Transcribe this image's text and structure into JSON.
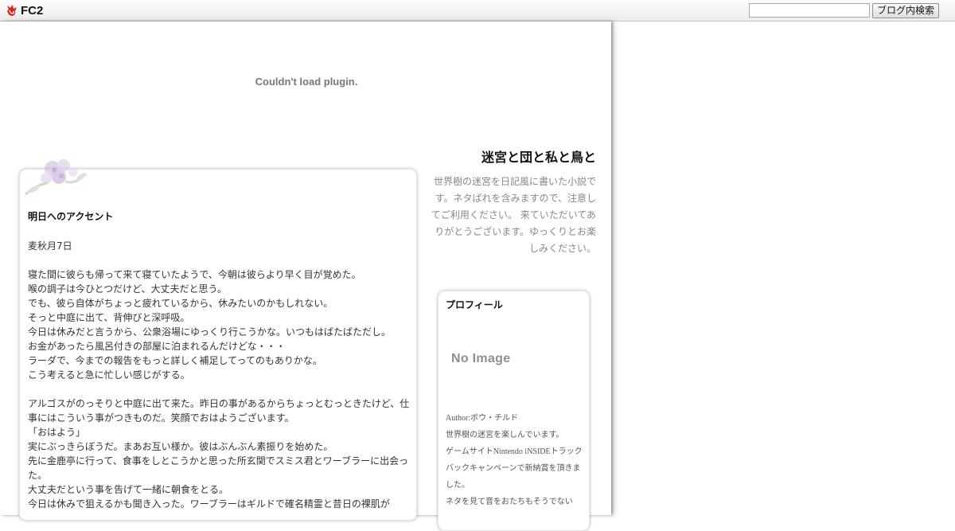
{
  "topbar": {
    "logo_text": "FC2",
    "logo_icon": "fc2-fox-logo-icon",
    "search_placeholder": "",
    "search_value": "",
    "search_button_label": "ブログ内検索"
  },
  "plugin": {
    "message": "Couldn't load plugin."
  },
  "blog": {
    "title": "迷宮と団と私と鳥と",
    "description": "世界樹の迷宮を日記風に書いた小説です。ネタばれを含みますので、注意してご利用ください。 来ていただいてありがとうございます。ゆっくりとお楽しみください。"
  },
  "entry": {
    "title": "明日へのアクセント",
    "date": "麦秋月7日",
    "paragraph1": [
      "寝た間に彼らも帰って来て寝ていたようで、今朝は彼らより早く目が覚めた。",
      "喉の調子は今ひとつだけど、大丈夫だと思う。",
      "でも、彼ら自体がちょっと疲れているから、休みたいのかもしれない。",
      "そっと中庭に出て、背伸びと深呼吸。",
      "今日は休みだと言うから、公衆浴場にゆっくり行こうかな。いつもはばたばただし。",
      "お金があったら風呂付きの部屋に泊まれるんだけどな・・・",
      "ラーダで、今までの報告をもっと詳しく補足してってのもありかな。",
      "こう考えると急に忙しい感じがする。"
    ],
    "paragraph2": [
      "アルゴスがのっそりと中庭に出て来た。昨日の事があるからちょっとむっときたけど、仕事にはこういう事がつきものだ。笑顔でおはようございます。",
      "「おはよう」",
      "実にぶっきらぼうだ。まあお互い様か。彼はぶんぶん素振りを始めた。",
      "先に金鹿亭に行って、食事をしとこうかと思った所玄関でスミス君とワーブラーに出会った。",
      "大丈夫だという事を告げて一緒に朝食をとる。",
      "今日は休みで狙えるかも聞き入った。ワーブラーはギルドで確名精霊と昔日の裸肌が"
    ]
  },
  "profile": {
    "title": "プロフィール",
    "no_image_text": "No Image",
    "author_line": "Author:ボウ・チルド",
    "lines": [
      "世界樹の迷宮を楽しんでいます。",
      "ゲームサイトNintendo iNSIDEトラックバックキャンペーンで新納賞を頂きました。",
      "ネタを見て音をおたちもそうでない"
    ]
  },
  "colors": {
    "plugin_text": "#777777",
    "description_text": "#888888",
    "no_image_text": "#8f8f8f",
    "logo_red": "#d9261c"
  }
}
